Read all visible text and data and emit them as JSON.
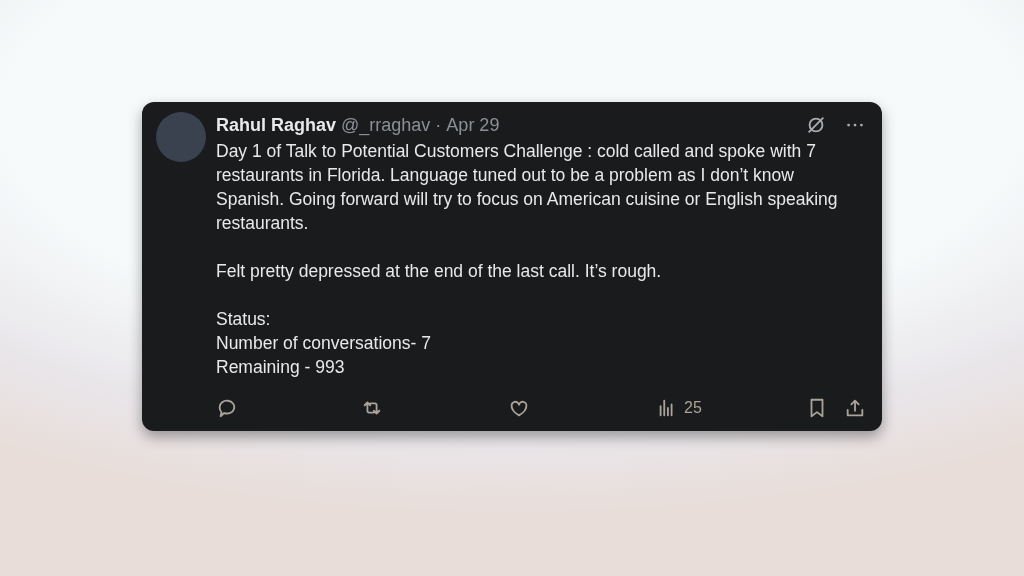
{
  "post": {
    "author": "Rahul Raghav",
    "handle": "@_rraghav",
    "separator": "·",
    "date": "Apr 29",
    "paragraphs": [
      [
        "Day 1 of Talk to Potential Customers Challenge : cold called and spoke with 7 restaurants in Florida. Language tuned out to be a problem as I don’t know Spanish. Going forward will try to focus on American cuisine or English speaking restaurants."
      ],
      [
        "Felt pretty depressed at the end of the last call. It’s rough."
      ],
      [
        "Status:",
        "Number of conversations- 7",
        "Remaining - 993"
      ]
    ],
    "actions": [
      {
        "kind": "reply"
      },
      {
        "kind": "repost"
      },
      {
        "kind": "like"
      },
      {
        "kind": "views",
        "count": "25"
      },
      {
        "kind": "bookmark"
      },
      {
        "kind": "share"
      }
    ]
  }
}
